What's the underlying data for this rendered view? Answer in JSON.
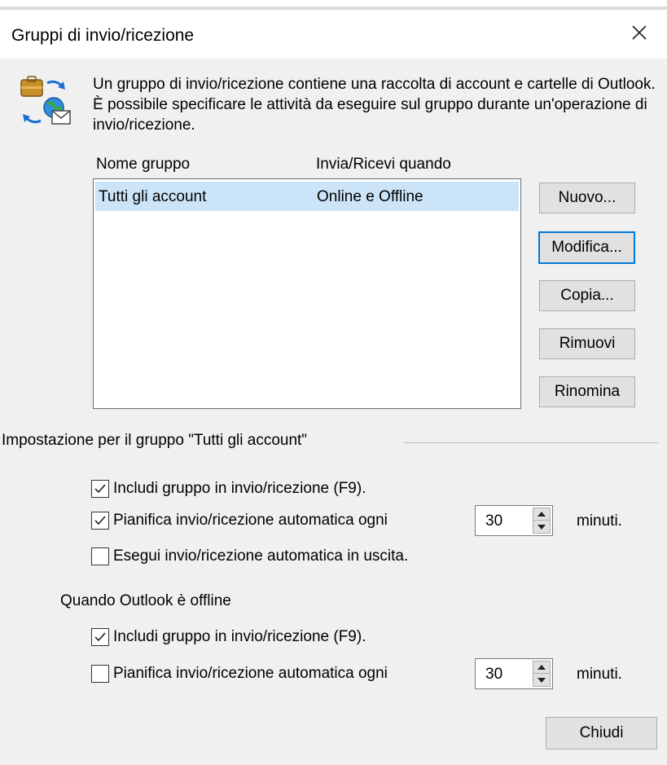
{
  "window": {
    "title": "Gruppi di invio/ricezione",
    "close_label": "×"
  },
  "intro_text": "Un gruppo di invio/ricezione contiene una raccolta di account e cartelle di Outlook. È possibile specificare le attività da eseguire sul gruppo durante un'operazione di invio/ricezione.",
  "list": {
    "columns": [
      "Nome gruppo",
      "Invia/Ricevi quando"
    ],
    "rows": [
      {
        "name": "Tutti gli account",
        "when": "Online e Offline",
        "selected": true
      }
    ]
  },
  "buttons": {
    "new": "Nuovo...",
    "edit": "Modifica...",
    "copy": "Copia...",
    "remove": "Rimuovi",
    "rename": "Rinomina",
    "close": "Chiudi"
  },
  "settings": {
    "group_label": "Impostazione per il gruppo \"Tutti gli account\"",
    "online": {
      "include": {
        "label": "Includi gruppo in invio/ricezione (F9).",
        "checked": true
      },
      "schedule": {
        "label": "Pianifica invio/ricezione automatica ogni",
        "checked": true,
        "minutes": "30",
        "unit": "minuti."
      },
      "on_exit": {
        "label": "Esegui invio/ricezione automatica in uscita.",
        "checked": false
      }
    },
    "offline_label": "Quando Outlook è offline",
    "offline": {
      "include": {
        "label": "Includi gruppo in invio/ricezione (F9).",
        "checked": true
      },
      "schedule": {
        "label": "Pianifica invio/ricezione automatica ogni",
        "checked": false,
        "minutes": "30",
        "unit": "minuti."
      }
    }
  },
  "icons": {
    "app": "send-receive-groups-icon",
    "close": "close-icon",
    "check": "checkmark-icon",
    "spin_up": "spin-up-icon",
    "spin_down": "spin-down-icon"
  },
  "colors": {
    "dialog_bg": "#f0f0f0",
    "selection": "#cce4f7",
    "default_button_border": "#0078d7",
    "button_bg": "#e1e1e1"
  }
}
